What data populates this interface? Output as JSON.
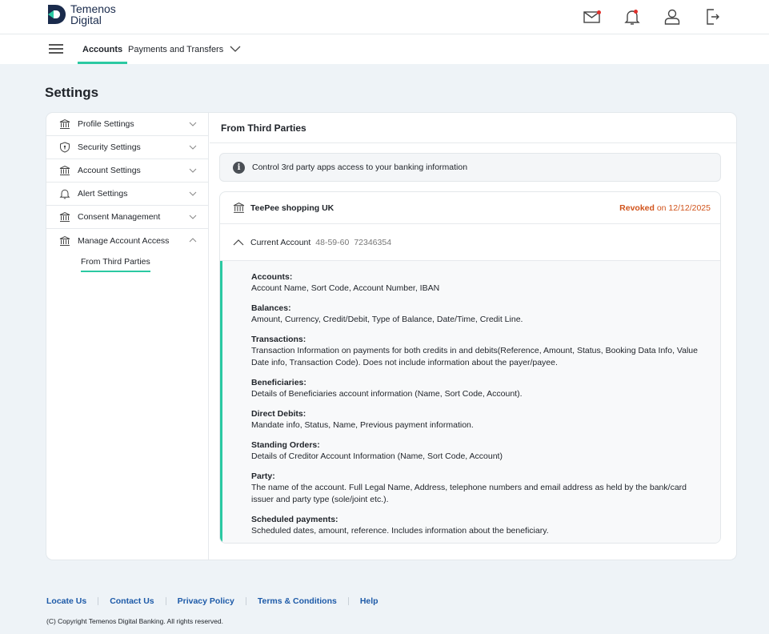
{
  "brand": {
    "line1": "Temenos",
    "line2": "Digital",
    "accent": "#2bc9a2",
    "mark_color": "#1a2b4c"
  },
  "header_icons": [
    "mail-icon",
    "bell-icon",
    "user-icon",
    "logout-icon"
  ],
  "nav": {
    "accounts": "Accounts",
    "payments": "Payments and Transfers"
  },
  "page_title": "Settings",
  "sidebar": {
    "items": [
      {
        "label": "Profile Settings",
        "icon": "bank-icon"
      },
      {
        "label": "Security Settings",
        "icon": "shield-icon"
      },
      {
        "label": "Account Settings",
        "icon": "bank-icon"
      },
      {
        "label": "Alert Settings",
        "icon": "bell-icon"
      },
      {
        "label": "Consent Management",
        "icon": "bank-icon"
      },
      {
        "label": "Manage Account Access",
        "icon": "bank-icon"
      }
    ],
    "sub_item": "From Third Parties"
  },
  "main": {
    "title": "From Third Parties",
    "info": "Control 3rd party apps access to your banking information",
    "provider": "TeePee shopping UK",
    "revoked_label": "Revoked",
    "revoked_on": " on 12/12/2025",
    "account_name": "Current Account",
    "sort_code": "48-59-60",
    "account_number": "72346354",
    "permissions": [
      {
        "heading": "Accounts:",
        "detail": "Account Name, Sort Code, Account Number, IBAN"
      },
      {
        "heading": "Balances:",
        "detail": "Amount, Currency, Credit/Debit, Type of Balance, Date/Time, Credit Line."
      },
      {
        "heading": "Transactions:",
        "detail": "Transaction Information on payments for both credits in and debits(Reference, Amount, Status, Booking Data Info, Value Date info, Transaction Code). Does not include information about the payer/payee."
      },
      {
        "heading": "Beneficiaries:",
        "detail": "Details of Beneficiaries account information (Name, Sort Code, Account)."
      },
      {
        "heading": "Direct Debits:",
        "detail": "Mandate info, Status, Name, Previous payment information."
      },
      {
        "heading": "Standing Orders:",
        "detail": "Details of Creditor Account Information (Name, Sort Code, Account)"
      },
      {
        "heading": "Party:",
        "detail": "The name of the account. Full Legal Name, Address, telephone numbers and email address as held by the bank/card issuer and party type (sole/joint etc.)."
      },
      {
        "heading": "Scheduled payments:",
        "detail": "Scheduled dates, amount, reference. Includes information about the beneficiary."
      }
    ]
  },
  "footer": {
    "links": [
      "Locate Us",
      "Contact Us",
      "Privacy Policy",
      "Terms & Conditions",
      "Help"
    ],
    "copyright": "(C) Copyright Temenos Digital Banking. All rights reserved."
  }
}
